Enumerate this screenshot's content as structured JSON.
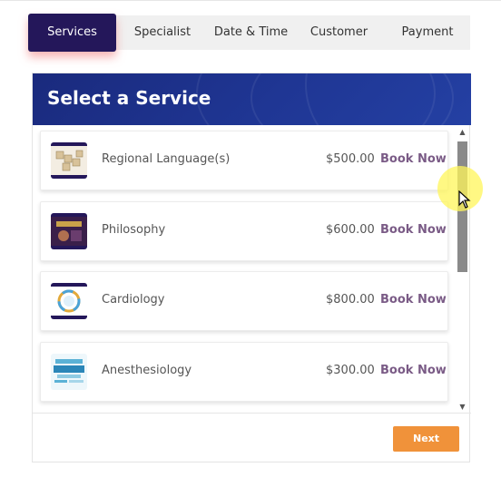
{
  "tabs": [
    {
      "label": "Services"
    },
    {
      "label": "Specialist"
    },
    {
      "label": "Date & Time"
    },
    {
      "label": "Customer"
    },
    {
      "label": "Payment"
    }
  ],
  "active_tab": "Services",
  "panel": {
    "title": "Select a Service"
  },
  "services": [
    {
      "name": "Regional Language(s)",
      "price": "$500.00",
      "action": "Book Now",
      "thumb": "scrabble-tiles-thumbnail"
    },
    {
      "name": "Philosophy",
      "price": "$600.00",
      "action": "Book Now",
      "thumb": "philosophy-book-thumbnail"
    },
    {
      "name": "Cardiology",
      "price": "$800.00",
      "action": "Book Now",
      "thumb": "heart-ring-thumbnail"
    },
    {
      "name": "Anesthesiology",
      "price": "$300.00",
      "action": "Book Now",
      "thumb": "health-word-cloud-thumbnail"
    }
  ],
  "footer": {
    "next_label": "Next"
  },
  "colors": {
    "active_tab": "#24175a",
    "header": "#1f3694",
    "book_now": "#7a5b86",
    "next_button": "#f0923a"
  }
}
